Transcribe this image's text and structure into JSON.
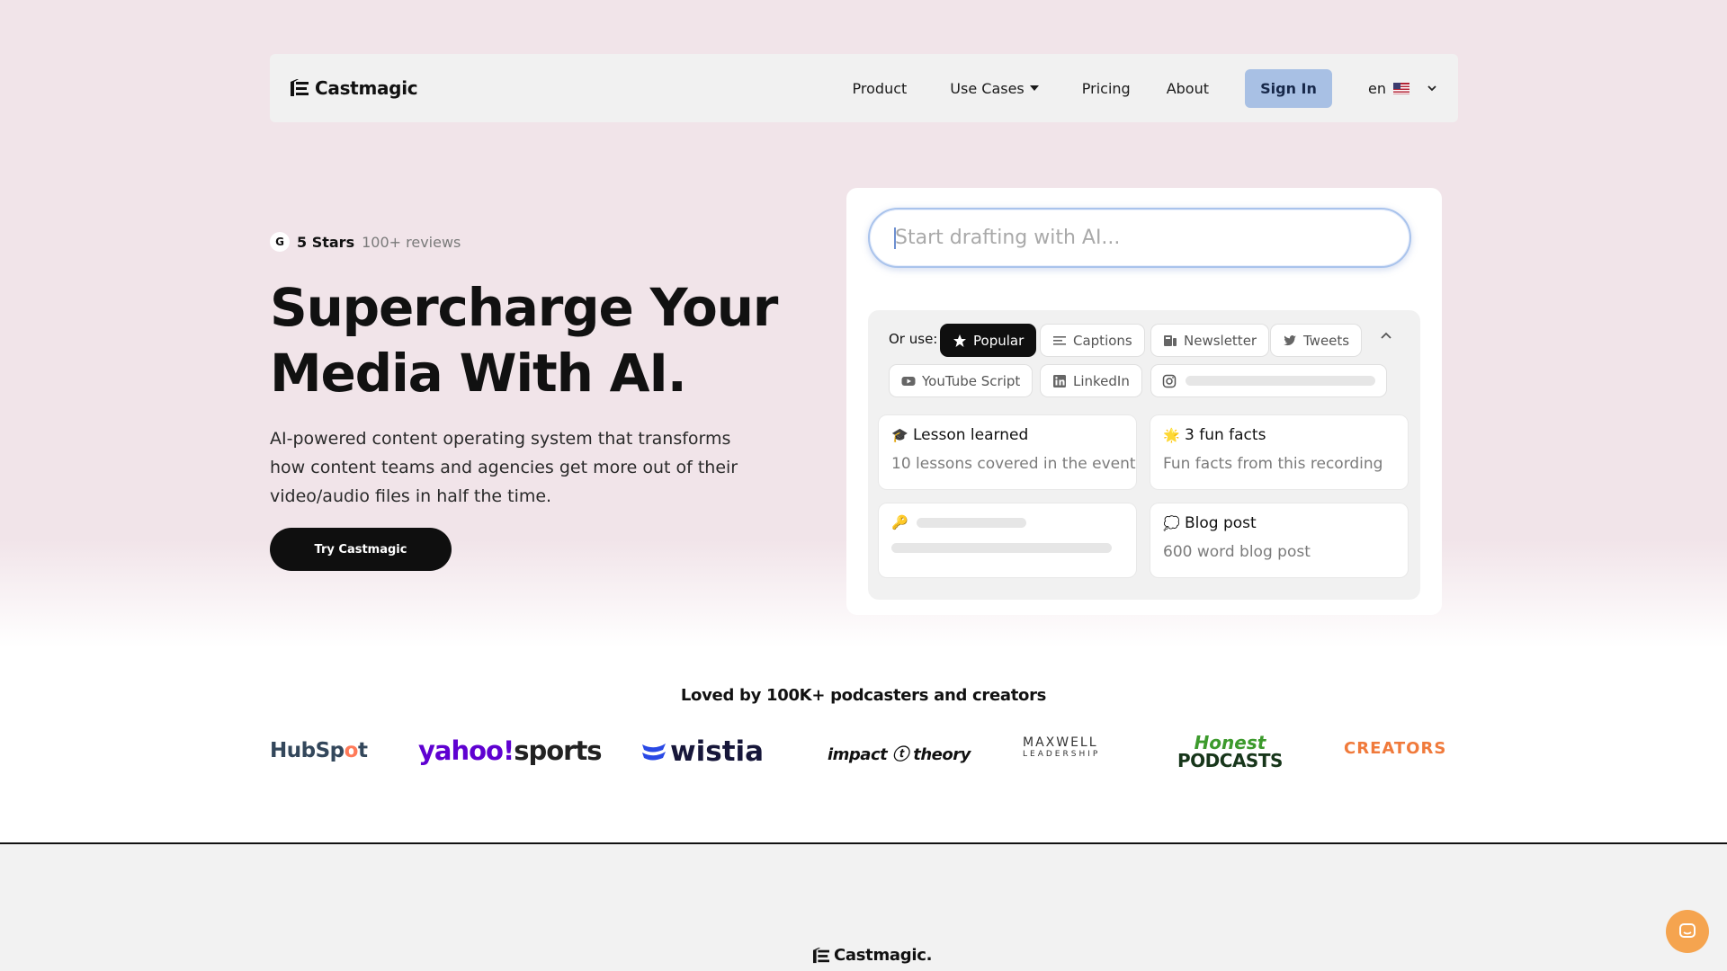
{
  "nav": {
    "brand": "Castmagic",
    "links": {
      "product": "Product",
      "use_cases": "Use Cases",
      "pricing": "Pricing",
      "about": "About"
    },
    "sign_in": "Sign In",
    "language": "en"
  },
  "hero": {
    "rating": {
      "stars": "5 Stars",
      "reviews": "100+ reviews"
    },
    "title_lines": [
      "Supercharge Your",
      "Media With AI."
    ],
    "description_lines": [
      "AI-powered content operating system that transforms",
      "how content teams and agencies get more out of their",
      "video/audio files in half the time."
    ],
    "cta": "Try Castmagic"
  },
  "drafting": {
    "input_placeholder": "Start drafting with AI...",
    "or_use_label": "Or use:",
    "chips": {
      "popular": "Popular",
      "captions": "Captions",
      "newsletter": "Newsletter",
      "tweets": "Tweets",
      "youtube_script": "YouTube Script",
      "linkedin": "LinkedIn"
    },
    "tiles": {
      "lesson": {
        "emoji": "🎓",
        "title": "Lesson learned",
        "subtitle": "10 lessons covered in the event"
      },
      "fun_facts": {
        "emoji": "🌟",
        "title": "3 fun facts",
        "subtitle": "Fun facts from this recording"
      },
      "key": {
        "emoji": "🔑"
      },
      "blog": {
        "emoji": "💭",
        "title": "Blog post",
        "subtitle": "600 word blog post"
      }
    }
  },
  "social_proof": {
    "heading": "Loved by 100K+ podcasters and creators",
    "brands": {
      "hubspot_a": "HubSp",
      "hubspot_o": "o",
      "hubspot_b": "t",
      "yahoo_a": "yahoo!",
      "yahoo_b": "sports",
      "wistia": "wistia",
      "impact": "impact ⓣ theory",
      "maxwell": "MAXWELL",
      "maxwell_sub": "LEADERSHIP",
      "honest_a": "Honest",
      "honest_b": "PODCASTS",
      "creators": "CREATORS"
    }
  },
  "footer": {
    "brand": "Castmagic."
  },
  "colors": {
    "sign_in_bg": "#a8c0e4",
    "cta_bg": "#0f0f0f",
    "chat_bubble": "#f5a44f",
    "input_border": "#a9c3ec"
  },
  "icons": {
    "logo": "castmagic-logo-icon",
    "flag": "us-flag-icon",
    "chat": "chat-icon"
  }
}
